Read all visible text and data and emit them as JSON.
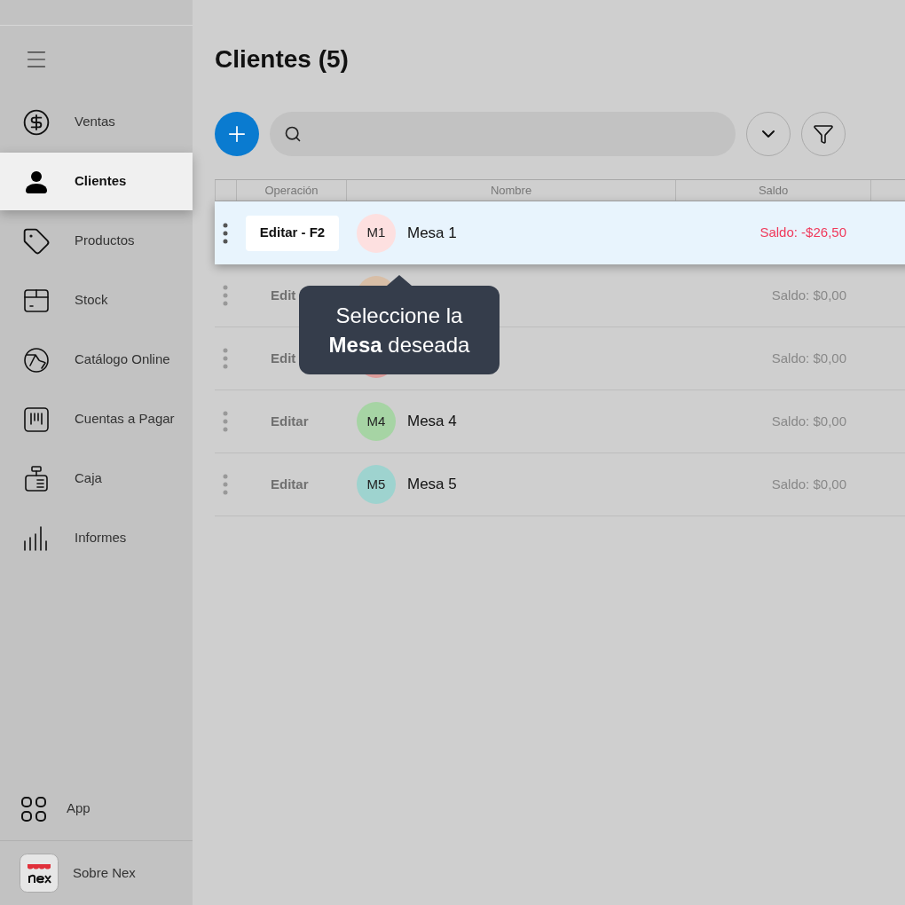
{
  "sidebar": {
    "items": [
      {
        "label": "Ventas",
        "selected": false
      },
      {
        "label": "Clientes",
        "selected": true
      },
      {
        "label": "Productos",
        "selected": false
      },
      {
        "label": "Stock",
        "selected": false
      },
      {
        "label": "Catálogo Online",
        "selected": false
      },
      {
        "label": "Cuentas a Pagar",
        "selected": false
      },
      {
        "label": "Caja",
        "selected": false
      },
      {
        "label": "Informes",
        "selected": false
      }
    ],
    "footer": [
      {
        "label": "App",
        "kind": "grid"
      },
      {
        "label": "Sobre Nex",
        "kind": "logo"
      }
    ]
  },
  "title": "Clientes (5)",
  "table": {
    "columns": [
      "Operación",
      "Nombre",
      "Saldo"
    ],
    "rows": [
      {
        "selected": true,
        "edit": "Editar - F2",
        "avatar": {
          "initials": "M1",
          "color": "#fde0e0"
        },
        "name": "Mesa 1",
        "saldo": "Saldo: -$26,50",
        "negative": true
      },
      {
        "selected": false,
        "edit": "Edit",
        "avatar": {
          "color": "#d8bea6"
        },
        "saldo": "Saldo: $0,00",
        "negative": false
      },
      {
        "selected": false,
        "edit": "Edit",
        "avatar": {
          "color": "#dc9c9a"
        },
        "saldo": "Saldo: $0,00",
        "negative": false
      },
      {
        "selected": false,
        "edit": "Editar",
        "avatar": {
          "initials": "M4",
          "color": "#a6d4a4"
        },
        "name": "Mesa 4",
        "saldo": "Saldo: $0,00",
        "negative": false
      },
      {
        "selected": false,
        "edit": "Editar",
        "avatar": {
          "initials": "M5",
          "color": "#9ed3cf"
        },
        "name": "Mesa 5",
        "saldo": "Saldo: $0,00",
        "negative": false
      }
    ]
  },
  "tooltip": "Seleccione la **Mesa** deseada"
}
